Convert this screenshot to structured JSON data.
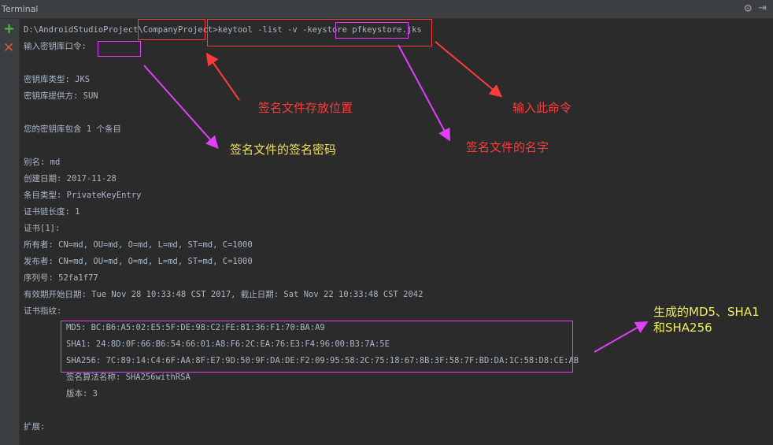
{
  "window": {
    "title": "Terminal"
  },
  "terminal": {
    "cmd_prefix": "D:\\AndroidStudioProject\\",
    "cmd_project": "CompanyProject",
    "cmd_sep": ">",
    "cmd_command": "keytool -list -v -keystore ",
    "cmd_file": "pfkeystore.jks",
    "password_prompt": "输入密钥库口令:",
    "keystore_type": "密钥库类型: JKS",
    "keystore_provider": "密钥库提供方: SUN",
    "entries_count": "您的密钥库包含 1 个条目",
    "alias": "别名: md",
    "created": "创建日期: 2017-11-28",
    "entry_type": "条目类型: PrivateKeyEntry",
    "chain_length": "证书链长度: 1",
    "cert_index": "证书[1]:",
    "owner": "所有者: CN=md, OU=md, O=md, L=md, ST=md, C=1000",
    "issuer": "发布者: CN=md, OU=md, O=md, L=md, ST=md, C=1000",
    "serial": "序列号: 52fa1f77",
    "validity": "有效期开始日期: Tue Nov 28 10:33:48 CST 2017, 截止日期: Sat Nov 22 10:33:48 CST 2042",
    "fingerprints_label": "证书指纹:",
    "md5": "MD5: BC:B6:A5:02:E5:5F:DE:98:C2:FE:81:36:F1:70:BA:A9",
    "sha1": "SHA1: 24:8D:0F:66:B6:54:66:01:A8:F6:2C:EA:76:E3:F4:96:00:B3:7A:5E",
    "sha256": "SHA256: 7C:89:14:C4:6F:AA:8F:E7:9D:50:9F:DA:DE:F2:09:95:58:2C:75:18:67:8B:3F:58:7F:BD:DA:1C:58:D8:CE:AB",
    "sig_alg": "签名算法名称: SHA256withRSA",
    "version": "版本: 3",
    "extensions": "扩展:"
  },
  "annotations": {
    "location": "签名文件存放位置",
    "command": "输入此命令",
    "password": "签名文件的签名密码",
    "filename": "签名文件的名字",
    "hashes_line1": "生成的MD5、SHA1",
    "hashes_line2": "和SHA256"
  },
  "icons": {
    "add": "plus-icon",
    "close": "close-icon",
    "settings": "gear-icon",
    "hide": "hide-icon"
  },
  "colors": {
    "red": "#ff3b3b",
    "magenta": "#e040fb",
    "yellow": "#f0e060",
    "bg": "#2b2b2b"
  }
}
